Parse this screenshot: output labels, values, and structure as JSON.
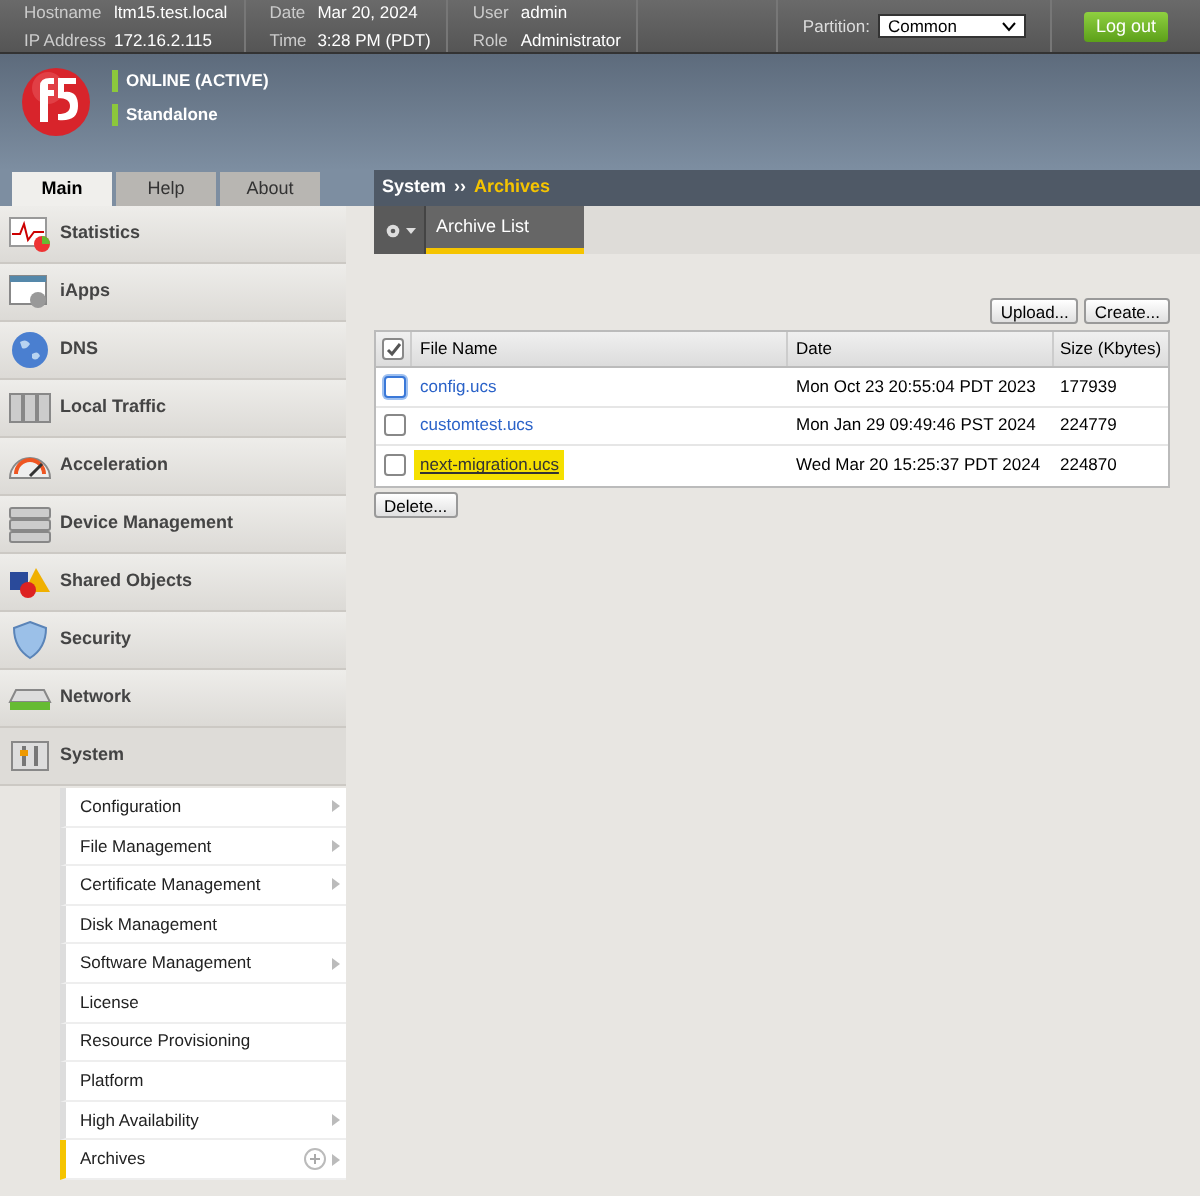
{
  "header": {
    "fields": [
      {
        "label": "Hostname",
        "value": "ltm15.test.local"
      },
      {
        "label": "IP Address",
        "value": "172.16.2.115"
      },
      {
        "label": "Date",
        "value": "Mar 20, 2024"
      },
      {
        "label": "Time",
        "value": "3:28 PM (PDT)"
      },
      {
        "label": "User",
        "value": "admin"
      },
      {
        "label": "Role",
        "value": "Administrator"
      }
    ],
    "partition_label": "Partition:",
    "partition_value": "Common",
    "logout": "Log out"
  },
  "status": [
    "ONLINE (ACTIVE)",
    "Standalone"
  ],
  "tabs": [
    {
      "label": "Main",
      "selected": true
    },
    {
      "label": "Help",
      "selected": false
    },
    {
      "label": "About",
      "selected": false
    }
  ],
  "sidebar": {
    "items": [
      {
        "label": "Statistics",
        "expanded": false
      },
      {
        "label": "iApps",
        "expanded": false
      },
      {
        "label": "DNS",
        "expanded": false
      },
      {
        "label": "Local Traffic",
        "expanded": false
      },
      {
        "label": "Acceleration",
        "expanded": false
      },
      {
        "label": "Device Management",
        "expanded": false
      },
      {
        "label": "Shared Objects",
        "expanded": false
      },
      {
        "label": "Security",
        "expanded": false
      },
      {
        "label": "Network",
        "expanded": false
      },
      {
        "label": "System",
        "expanded": true,
        "children": [
          {
            "label": "Configuration",
            "selected": false,
            "has_submenu": true
          },
          {
            "label": "File Management",
            "selected": false,
            "has_submenu": true
          },
          {
            "label": "Certificate Management",
            "selected": false,
            "has_submenu": true
          },
          {
            "label": "Disk Management",
            "selected": false,
            "has_submenu": false
          },
          {
            "label": "Software Management",
            "selected": false,
            "has_submenu": true
          },
          {
            "label": "License",
            "selected": false,
            "has_submenu": false
          },
          {
            "label": "Resource Provisioning",
            "selected": false,
            "has_submenu": false
          },
          {
            "label": "Platform",
            "selected": false,
            "has_submenu": false
          },
          {
            "label": "High Availability",
            "selected": false,
            "has_submenu": true
          },
          {
            "label": "Archives",
            "selected": true,
            "has_submenu": true
          }
        ]
      }
    ]
  },
  "breadcrumb": {
    "parent": "System",
    "separator": "››",
    "current": "Archives"
  },
  "subtabs": [
    {
      "label": "Archive List",
      "selected": true
    }
  ],
  "buttons_top": [
    "Upload...",
    "Create..."
  ],
  "table": {
    "header_checked": true,
    "columns": [
      "File Name",
      "Date",
      "Size (Kbytes)"
    ],
    "rows": [
      {
        "checked": false,
        "focused": true,
        "highlighted": false,
        "name": "config.ucs",
        "date": "Mon Oct 23 20:55:04 PDT 2023",
        "size": "177939"
      },
      {
        "checked": false,
        "focused": false,
        "highlighted": false,
        "name": "customtest.ucs",
        "date": "Mon Jan 29 09:49:46 PST 2024",
        "size": "224779"
      },
      {
        "checked": false,
        "focused": false,
        "highlighted": true,
        "name": "next-migration.ucs",
        "date": "Wed Mar 20 15:25:37 PDT 2024",
        "size": "224870"
      }
    ]
  },
  "buttons_bottom": [
    "Delete..."
  ]
}
